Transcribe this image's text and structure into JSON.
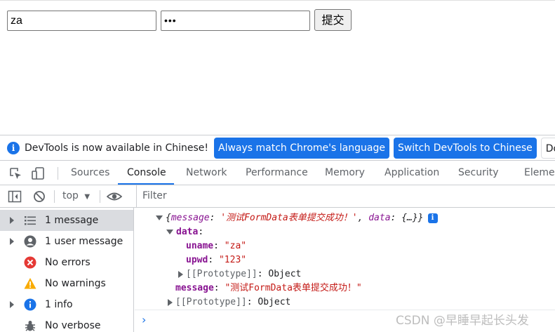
{
  "page": {
    "username_value": "za",
    "password_value": "•••",
    "submit_label": "提交"
  },
  "infobar": {
    "message": "DevTools is now available in Chinese!",
    "match_language_button": "Always match Chrome's language",
    "switch_button": "Switch DevTools to Chinese",
    "dont_show_button": "Don't sh"
  },
  "tabs": [
    {
      "label": "Sources"
    },
    {
      "label": "Console"
    },
    {
      "label": "Network"
    },
    {
      "label": "Performance"
    },
    {
      "label": "Memory"
    },
    {
      "label": "Application"
    },
    {
      "label": "Security"
    },
    {
      "label": "Elemen"
    }
  ],
  "toolbar": {
    "context": "top",
    "filter_placeholder": "Filter"
  },
  "sidebar": {
    "items": [
      {
        "label": "1 message",
        "icon": "list-icon"
      },
      {
        "label": "1 user message",
        "icon": "user-icon"
      },
      {
        "label": "No errors",
        "icon": "error-icon"
      },
      {
        "label": "No warnings",
        "icon": "warning-icon"
      },
      {
        "label": "1 info",
        "icon": "info-icon"
      },
      {
        "label": "No verbose",
        "icon": "bug-icon"
      }
    ]
  },
  "console": {
    "summary": {
      "open": "{",
      "message_key": "message",
      "colon": ": ",
      "message_value": "'测试FormData表单提交成功！'",
      "comma": ", ",
      "data_key": "data",
      "data_value": "{…}",
      "close": "}"
    },
    "data_key": "data",
    "uname_key": "uname",
    "uname_value": "\"za\"",
    "upwd_key": "upwd",
    "upwd_value": "\"123\"",
    "inner_prototype": "[[Prototype]]",
    "inner_prototype_value": "Object",
    "message_key": "message",
    "message_value": "\"测试FormData表单提交成功！\"",
    "outer_prototype": "[[Prototype]]",
    "outer_prototype_value": "Object",
    "prompt": "›"
  },
  "watermark": "CSDN @早睡早起长头发",
  "colors": {
    "accent": "#1a73e8",
    "key": "#881391",
    "string": "#c41a16",
    "error": "#e53935",
    "warning": "#f9ab00"
  }
}
